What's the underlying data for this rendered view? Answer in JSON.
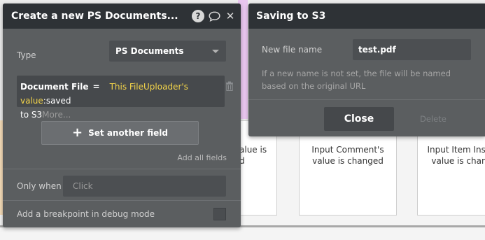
{
  "background": {
    "cards": [
      {
        "text_line1": "alue is",
        "text_line2": "d"
      },
      {
        "text_line1": "Input Comment's",
        "text_line2": "value is changed"
      },
      {
        "text_line1": "Input Item Insp",
        "text_line2": "value is chan"
      }
    ]
  },
  "left_panel": {
    "title": "Create a new PS Documents...",
    "help_glyph": "?",
    "close_glyph": "✕",
    "type_label": "Type",
    "type_value": "PS Documents",
    "field": {
      "label": "Document File",
      "operator": "=",
      "value_highlight": "This FileUploader's value",
      "value_rest": ":saved",
      "value_line2": "to S3",
      "more": "More..."
    },
    "set_another_field": "Set another field",
    "plus_glyph": "+",
    "add_all_fields": "Add all fields",
    "only_when_label": "Only when",
    "only_when_placeholder": "Click",
    "breakpoint_label": "Add a breakpoint in debug mode"
  },
  "right_panel": {
    "title": "Saving to S3",
    "new_file_name_label": "New file name",
    "new_file_name_value": "test.pdf",
    "hint": "If a new name is not set, the file will be named based on the original URL",
    "close_button": "Close",
    "delete_button": "Delete"
  },
  "colors": {
    "panel_bg": "#5b5e60",
    "header_bg": "#2e3236",
    "highlight_yellow": "#f3d44a"
  },
  "icons": [
    "help-icon",
    "comment-icon",
    "close-icon",
    "trash-icon",
    "chevron-down-icon",
    "plus-icon"
  ]
}
